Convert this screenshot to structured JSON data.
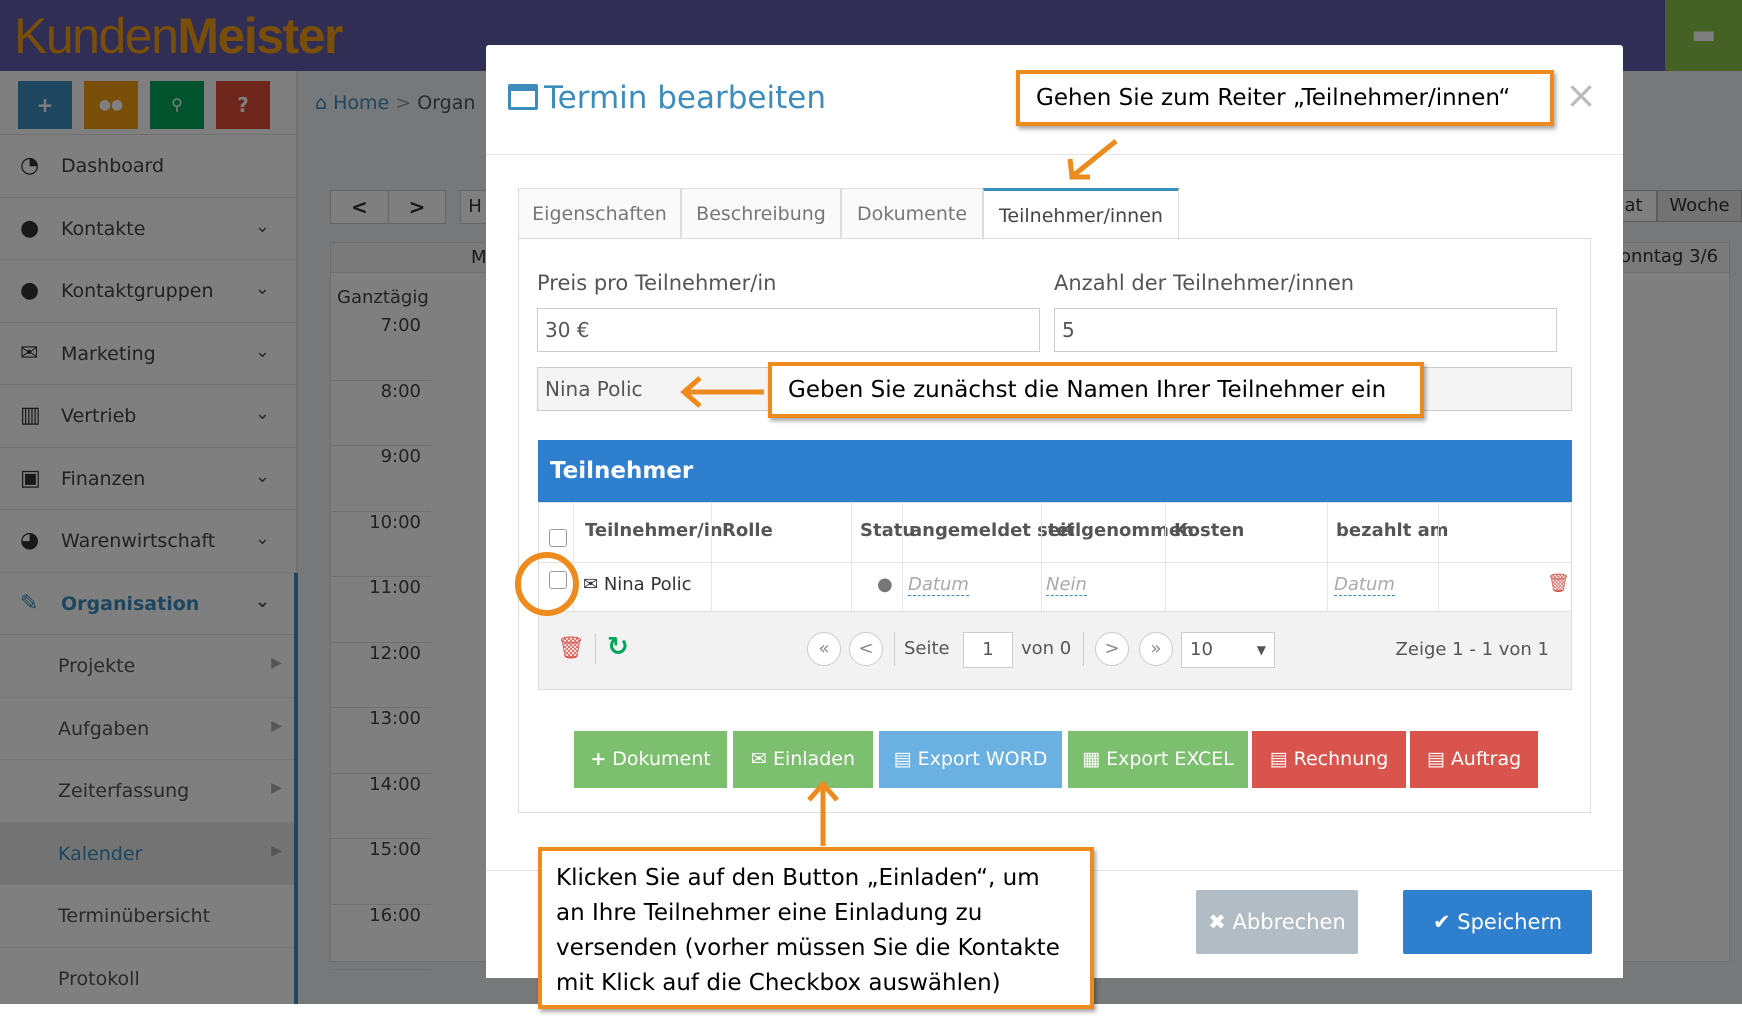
{
  "app": {
    "logo_light": "Kunden",
    "logo_bold": "Meister"
  },
  "toolbar_icons": [
    "plus-icon",
    "chat-icon",
    "search-icon",
    "help-icon"
  ],
  "toolbar_labels": {
    "plus": "+",
    "chat": "💬",
    "search": "🔍",
    "help": "?"
  },
  "breadcrumb": {
    "home": "Home",
    "separator": ">",
    "current": "Organ"
  },
  "sidebar": {
    "items": [
      {
        "label": "Dashboard",
        "icon": "dashboard-icon"
      },
      {
        "label": "Kontakte",
        "icon": "user-icon"
      },
      {
        "label": "Kontaktgruppen",
        "icon": "users-icon"
      },
      {
        "label": "Marketing",
        "icon": "envelope-icon"
      },
      {
        "label": "Vertrieb",
        "icon": "bar-chart-icon"
      },
      {
        "label": "Finanzen",
        "icon": "money-icon"
      },
      {
        "label": "Warenwirtschaft",
        "icon": "globe-icon"
      },
      {
        "label": "Organisation",
        "icon": "edit-icon"
      }
    ],
    "sub_items": [
      {
        "label": "Projekte"
      },
      {
        "label": "Aufgaben"
      },
      {
        "label": "Zeiterfassung"
      },
      {
        "label": "Kalender"
      },
      {
        "label": "Terminübersicht"
      },
      {
        "label": "Protokoll"
      }
    ]
  },
  "calendar": {
    "prev": "<",
    "next": ">",
    "allday": "Ganztägig",
    "header_partial": "M",
    "view_partial_left": "H",
    "view_partial": "at",
    "view_week": "Woche",
    "day_label": "onntag 3/6",
    "times": [
      "7:00",
      "8:00",
      "9:00",
      "10:00",
      "11:00",
      "12:00",
      "13:00",
      "14:00",
      "15:00",
      "16:00"
    ]
  },
  "modal": {
    "title": "Termin bearbeiten",
    "close": "×",
    "tabs": [
      "Eigenschaften",
      "Beschreibung",
      "Dokumente",
      "Teilnehmer/innen"
    ],
    "price_label": "Preis pro Teilnehmer/in",
    "price_value": "30 €",
    "count_label": "Anzahl der Teilnehmer/innen",
    "count_value": "5",
    "name_input_value": "Nina Polic",
    "panel_title": "Teilnehmer",
    "columns": [
      "Teilnehmer/in",
      "Rolle",
      "Statu",
      "angemeldet seit",
      "teilgenommen",
      "Kosten",
      "bezahlt am"
    ],
    "row": {
      "name": "Nina Polic",
      "rolle": "",
      "status": "●",
      "angemeldet": "Datum",
      "teilgenommen": "Nein",
      "kosten": "",
      "bezahlt": "Datum"
    },
    "pager": {
      "first": "«",
      "prev": "<",
      "next": ">",
      "last": "»",
      "page_label": "Seite",
      "page_value": "1",
      "of_label": "von 0",
      "page_size": "10",
      "summary": "Zeige 1 - 1 von 1"
    },
    "actions": [
      {
        "label": "Dokument",
        "glyph": "+",
        "color": "#7cbf6e"
      },
      {
        "label": "Einladen",
        "glyph": "✉",
        "color": "#7cbf6e"
      },
      {
        "label": "Export WORD",
        "glyph": "▤",
        "color": "#6ab0e0"
      },
      {
        "label": "Export EXCEL",
        "glyph": "▦",
        "color": "#7cbf6e"
      },
      {
        "label": "Rechnung",
        "glyph": "▤",
        "color": "#d9544d"
      },
      {
        "label": "Auftrag",
        "glyph": "▤",
        "color": "#d9544d"
      }
    ],
    "cancel": "Abbrechen",
    "cancel_glyph": "✖",
    "save": "Speichern",
    "save_glyph": "✔"
  },
  "callouts": {
    "tab": "Gehen Sie zum Reiter „Teilnehmer/innen“",
    "names": "Geben Sie zunächst die Namen Ihrer Teilnehmer ein",
    "invite_1": "Klicken Sie auf den Button „Einladen“, um",
    "invite_2": "an Ihre Teilnehmer eine Einladung zu",
    "invite_3": "versenden (vorher müssen Sie die Kontakte",
    "invite_4": "mit Klick auf die Checkbox auswählen)"
  },
  "colors": {
    "accent": "#3c8dbc",
    "callout_border": "#ed8b1f",
    "header": "#605ca8",
    "panel": "#2f7fcf"
  }
}
